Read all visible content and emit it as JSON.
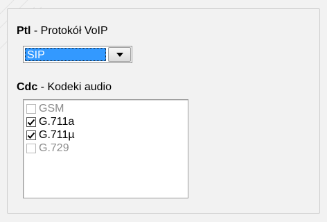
{
  "protocol": {
    "abbr": "Ptl",
    "separator": " - ",
    "description": "Protokół VoIP",
    "selected": "SIP"
  },
  "codecs": {
    "abbr": "Cdc",
    "separator": " - ",
    "description": "Kodeki audio",
    "items": [
      {
        "label": "GSM",
        "checked": false,
        "enabled": false
      },
      {
        "label": "G.711a",
        "checked": true,
        "enabled": true
      },
      {
        "label": "G.711µ",
        "checked": true,
        "enabled": true
      },
      {
        "label": "G.729",
        "checked": false,
        "enabled": false
      }
    ]
  },
  "colors": {
    "selection": "#3399ff",
    "disabled_text": "#8d8d8d",
    "background": "#f2f2f2"
  }
}
